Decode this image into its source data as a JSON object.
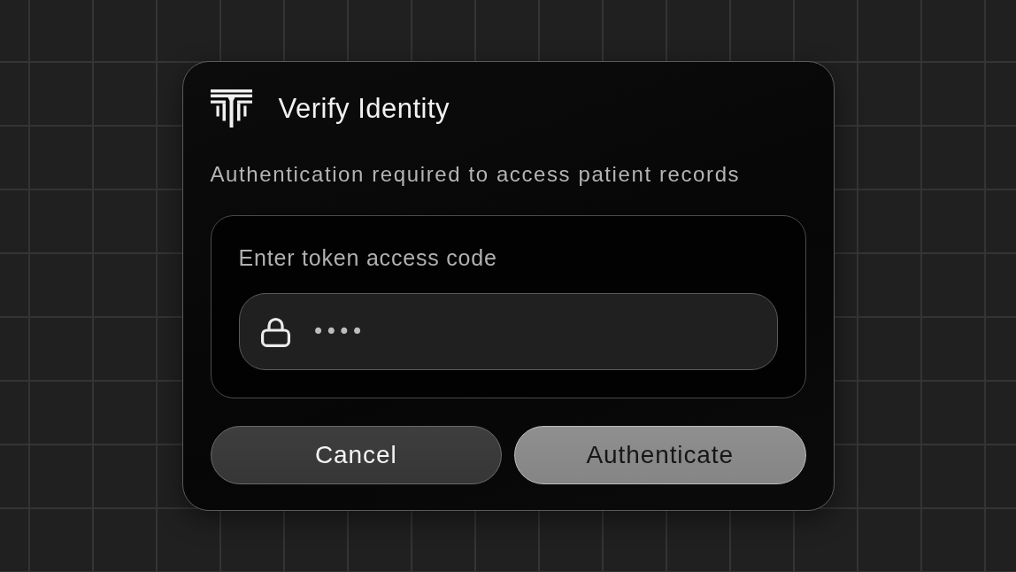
{
  "dialog": {
    "title": "Verify Identity",
    "subtitle": "Authentication required to access patient records",
    "code_panel": {
      "label": "Enter token access code",
      "field": {
        "value": "••••"
      }
    },
    "buttons": [
      {
        "label": "Cancel",
        "kind": "secondary"
      },
      {
        "label": "Authenticate",
        "kind": "primary"
      }
    ]
  }
}
